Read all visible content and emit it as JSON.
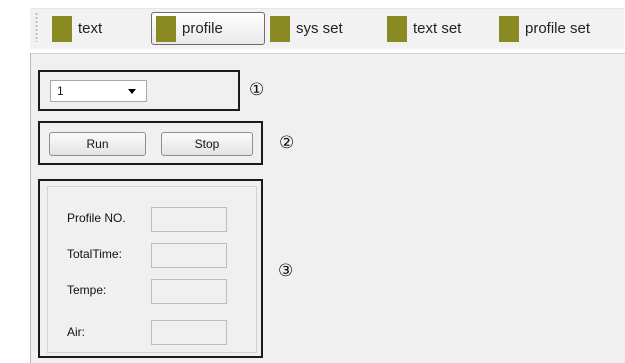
{
  "toolbar": {
    "tabs": [
      {
        "label": "text",
        "swatch": "#8a8a22",
        "active": false
      },
      {
        "label": "profile",
        "swatch": "#8a8a22",
        "active": true
      },
      {
        "label": "sys set",
        "swatch": "#8a8a22",
        "active": false
      },
      {
        "label": "text set",
        "swatch": "#8a8a22",
        "active": false
      },
      {
        "label": "profile set",
        "swatch": "#8a8a22",
        "active": false
      }
    ]
  },
  "selector": {
    "value": "1",
    "marker": "①"
  },
  "controls": {
    "run_label": "Run",
    "stop_label": "Stop",
    "marker": "②"
  },
  "profile_panel": {
    "marker": "③",
    "fields": [
      {
        "label": "Profile NO.",
        "value": ""
      },
      {
        "label": "TotalTime:",
        "value": ""
      },
      {
        "label": "Tempe:",
        "value": ""
      },
      {
        "label": "Air:",
        "value": ""
      }
    ]
  }
}
